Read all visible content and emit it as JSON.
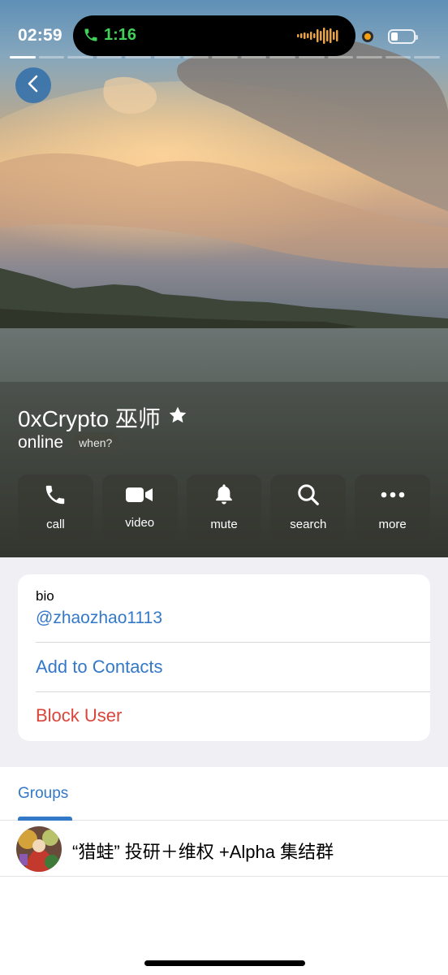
{
  "status_bar": {
    "time": "02:59",
    "call_duration": "1:16",
    "icons": [
      "phone-icon",
      "audio-wave-icon",
      "privacy-dot-icon",
      "battery-icon"
    ]
  },
  "colors": {
    "accent": "#3478c8",
    "danger": "#d9453b",
    "call_green": "#42d158"
  },
  "profile": {
    "name": "0xCrypto 巫师",
    "status": "online",
    "when_label": "when?"
  },
  "actions": [
    {
      "label": "call",
      "icon": "phone-icon"
    },
    {
      "label": "video",
      "icon": "video-camera-icon"
    },
    {
      "label": "mute",
      "icon": "bell-icon"
    },
    {
      "label": "search",
      "icon": "search-icon"
    },
    {
      "label": "more",
      "icon": "more-dots-icon"
    }
  ],
  "info": {
    "bio_label": "bio",
    "bio_value": "@zhaozhao1113",
    "add_contact": "Add to Contacts",
    "block_user": "Block User"
  },
  "tabs": {
    "groups": "Groups"
  },
  "groups": [
    {
      "name": "“猎蛙” 投研＋维权 +Alpha 集结群"
    }
  ]
}
